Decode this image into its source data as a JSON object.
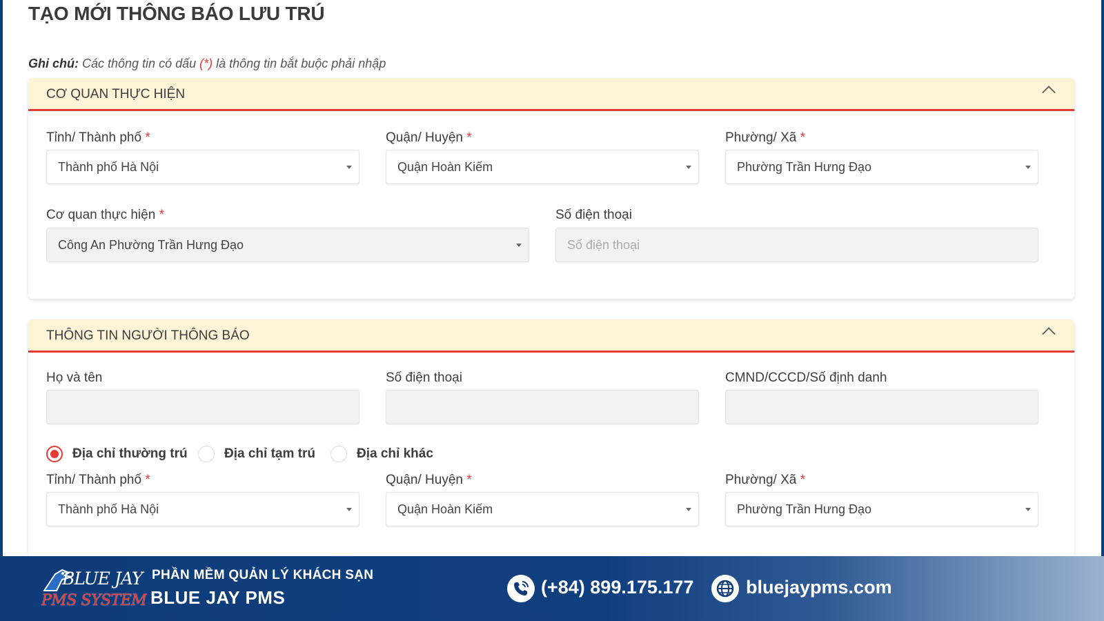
{
  "page": {
    "title": "TẠO MỚI THÔNG BÁO LƯU TRÚ",
    "note_label": "Ghi chú:",
    "note_text_before": " Các thông tin có dấu ",
    "note_required_mark": "(*)",
    "note_text_after": " là thông tin bắt buộc phải nhập"
  },
  "required_mark": "*",
  "section_agency": {
    "title": "CƠ QUAN THỰC HIỆN",
    "province": {
      "label": "Tỉnh/ Thành phố",
      "value": "Thành phố Hà Nội"
    },
    "district": {
      "label": "Quận/ Huyện",
      "value": "Quận Hoàn Kiếm"
    },
    "ward": {
      "label": "Phường/ Xã",
      "value": "Phường Trần Hưng Đạo"
    },
    "agency": {
      "label": "Cơ quan thực hiện",
      "value": "Công An Phường Trần Hưng Đạo"
    },
    "phone": {
      "label": "Số điện thoại",
      "placeholder": "Số điện thoại"
    }
  },
  "section_notifier": {
    "title": "THÔNG TIN NGƯỜI THÔNG BÁO",
    "full_name": {
      "label": "Họ và tên",
      "value": ""
    },
    "phone": {
      "label": "Số điện thoại",
      "value": ""
    },
    "id_number": {
      "label": "CMND/CCCD/Số định danh",
      "value": ""
    },
    "address_types": [
      {
        "label": "Địa chỉ thường trú",
        "selected": true
      },
      {
        "label": "Địa chỉ tạm trú",
        "selected": false
      },
      {
        "label": "Địa chỉ khác",
        "selected": false
      }
    ],
    "province": {
      "label": "Tỉnh/ Thành phố",
      "value": "Thành phố Hà Nội"
    },
    "district": {
      "label": "Quận/ Huyện",
      "value": "Quận Hoàn Kiếm"
    },
    "ward": {
      "label": "Phường/ Xã",
      "value": "Phường Trần Hưng Đạo"
    }
  },
  "footer": {
    "logo_top": "BLUE JAY",
    "logo_bottom": "PMS SYSTEM",
    "tagline": "PHẦN MỀM QUẢN LÝ KHÁCH SẠN",
    "brand": "BLUE JAY PMS",
    "phone": "(+84) 899.175.177",
    "website": "bluejaypms.com"
  },
  "colors": {
    "accent_red": "#e53935",
    "section_header_bg": "#fdf3d7",
    "footer_blue": "#0e3c7a"
  }
}
